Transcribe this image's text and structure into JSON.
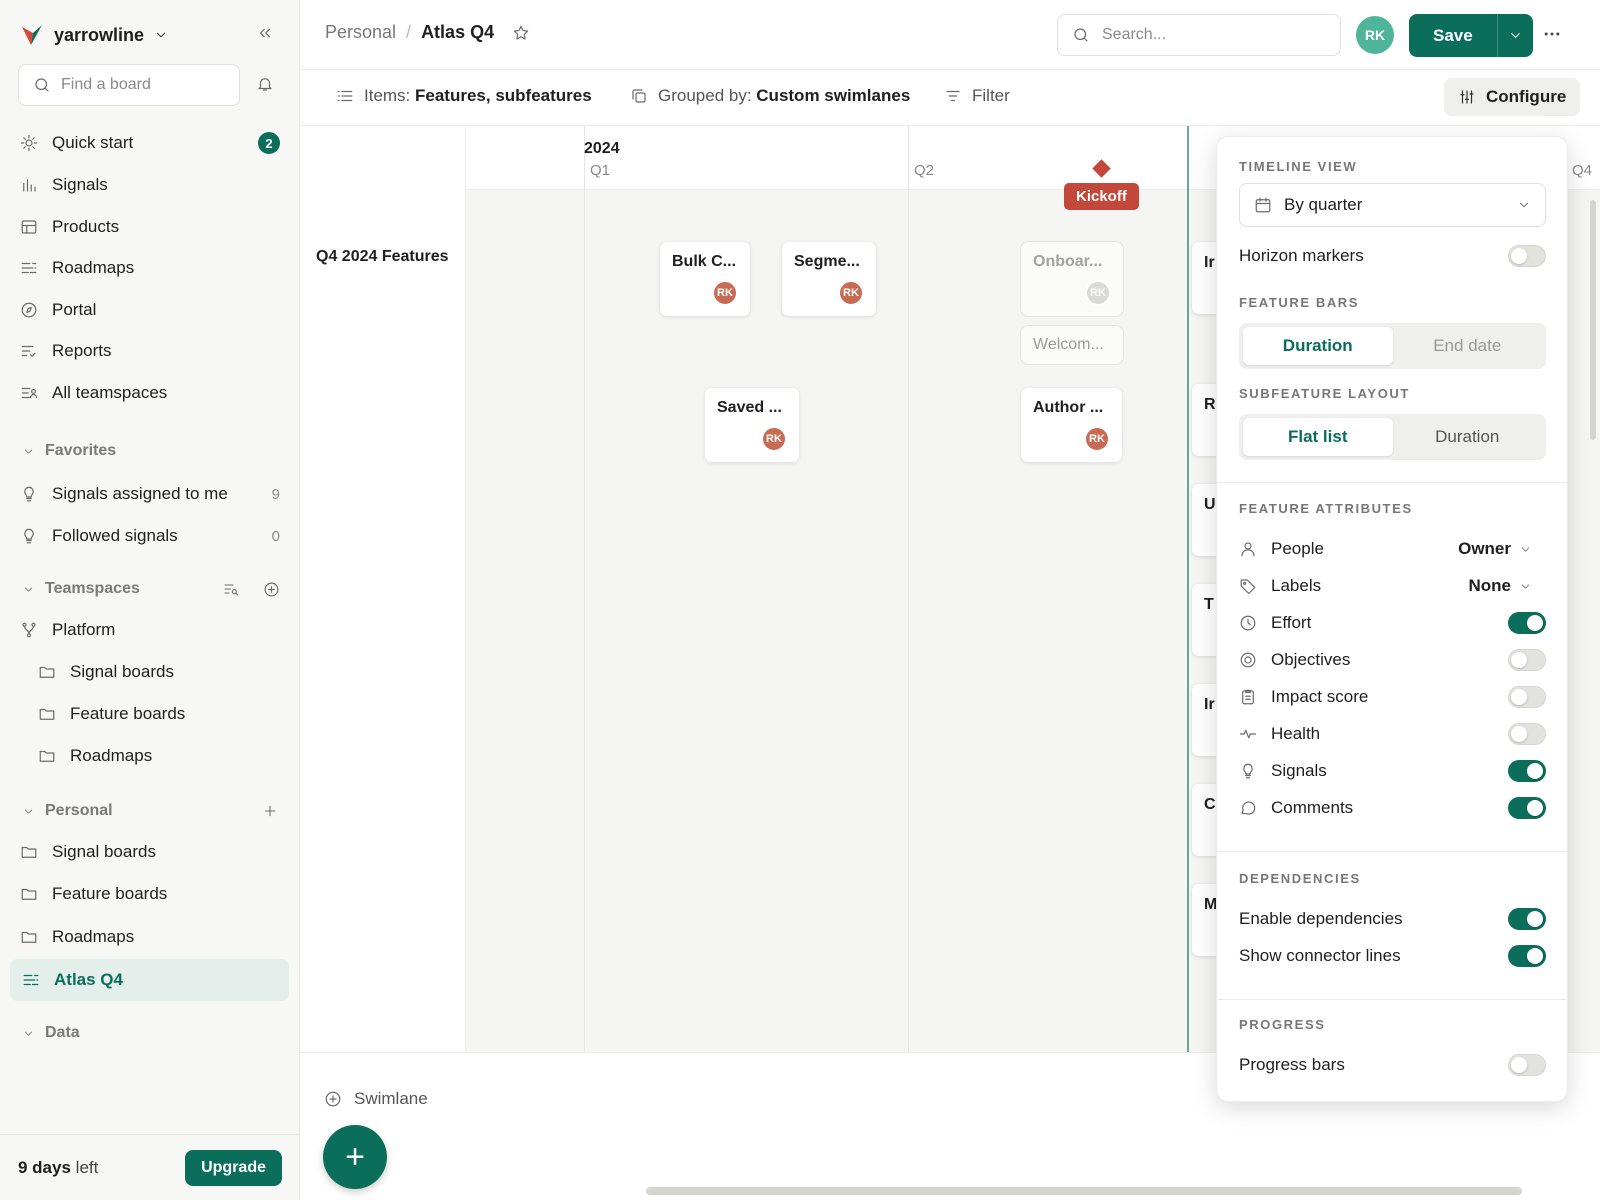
{
  "sidebar": {
    "workspace": "yarrowline",
    "find_placeholder": "Find a board",
    "quick_start": {
      "label": "Quick start",
      "badge": "2"
    },
    "items": [
      {
        "label": "Signals"
      },
      {
        "label": "Products"
      },
      {
        "label": "Roadmaps"
      },
      {
        "label": "Portal"
      },
      {
        "label": "Reports"
      },
      {
        "label": "All teamspaces"
      }
    ],
    "favorites": {
      "label": "Favorites",
      "items": [
        {
          "label": "Signals assigned to me",
          "count": "9"
        },
        {
          "label": "Followed signals",
          "count": "0"
        }
      ]
    },
    "teamspaces": {
      "label": "Teamspaces",
      "platform": "Platform",
      "items": [
        {
          "label": "Signal boards"
        },
        {
          "label": "Feature boards"
        },
        {
          "label": "Roadmaps"
        }
      ]
    },
    "personal": {
      "label": "Personal",
      "items": [
        {
          "label": "Signal boards"
        },
        {
          "label": "Feature boards"
        },
        {
          "label": "Roadmaps"
        },
        {
          "label": "Atlas Q4"
        }
      ]
    },
    "data_label": "Data",
    "trial_days": "9 days",
    "trial_suffix": " left",
    "upgrade": "Upgrade"
  },
  "header": {
    "breadcrumb_parent": "Personal",
    "breadcrumb_sep": "/",
    "breadcrumb_current": "Atlas Q4",
    "search_placeholder": "Search...",
    "avatar": "RK",
    "save": "Save"
  },
  "toolbar": {
    "items_prefix": "Items: ",
    "items_value": "Features, subfeatures",
    "grouped_prefix": "Grouped by: ",
    "grouped_value": "Custom swimlanes",
    "filter": "Filter",
    "configure": "Configure"
  },
  "timeline": {
    "year": "2024",
    "quarters": [
      "Q1",
      "Q2",
      "Q4"
    ],
    "marker": "Kickoff",
    "lane": "Q4 2024 Features",
    "cards": [
      {
        "title": "Bulk C...",
        "avatar": "RK"
      },
      {
        "title": "Segme...",
        "avatar": "RK"
      },
      {
        "title": "Onboar...",
        "avatar": "RK"
      },
      {
        "title": "Welcom..."
      },
      {
        "title": "Saved ...",
        "avatar": "RK"
      },
      {
        "title": "Author ...",
        "avatar": "RK"
      }
    ],
    "edge_cards": [
      "Ir",
      "R",
      "U",
      "T",
      "Ir",
      "C",
      "M"
    ],
    "add_swimlane": "Swimlane"
  },
  "panel": {
    "timeline_view": {
      "heading": "TIMELINE VIEW",
      "value": "By quarter",
      "horizon_markers": "Horizon markers",
      "horizon_on": false
    },
    "feature_bars": {
      "heading": "FEATURE BARS",
      "options": [
        "Duration",
        "End date"
      ],
      "selected": "Duration"
    },
    "subfeature_layout": {
      "heading": "SUBFEATURE LAYOUT",
      "options": [
        "Flat list",
        "Duration"
      ],
      "selected": "Flat list"
    },
    "feature_attributes": {
      "heading": "FEATURE ATTRIBUTES",
      "people": {
        "label": "People",
        "value": "Owner"
      },
      "labels": {
        "label": "Labels",
        "value": "None"
      },
      "toggles": [
        {
          "label": "Effort",
          "on": true
        },
        {
          "label": "Objectives",
          "on": false
        },
        {
          "label": "Impact score",
          "on": false
        },
        {
          "label": "Health",
          "on": false
        },
        {
          "label": "Signals",
          "on": true
        },
        {
          "label": "Comments",
          "on": true
        }
      ]
    },
    "dependencies": {
      "heading": "DEPENDENCIES",
      "toggles": [
        {
          "label": "Enable dependencies",
          "on": true
        },
        {
          "label": "Show connector lines",
          "on": true
        }
      ]
    },
    "progress": {
      "heading": "PROGRESS",
      "toggles": [
        {
          "label": "Progress bars",
          "on": false
        }
      ]
    }
  },
  "colors": {
    "accent": "#0b6e5a",
    "marker": "#c4483a",
    "avatar": "#c86b55"
  }
}
